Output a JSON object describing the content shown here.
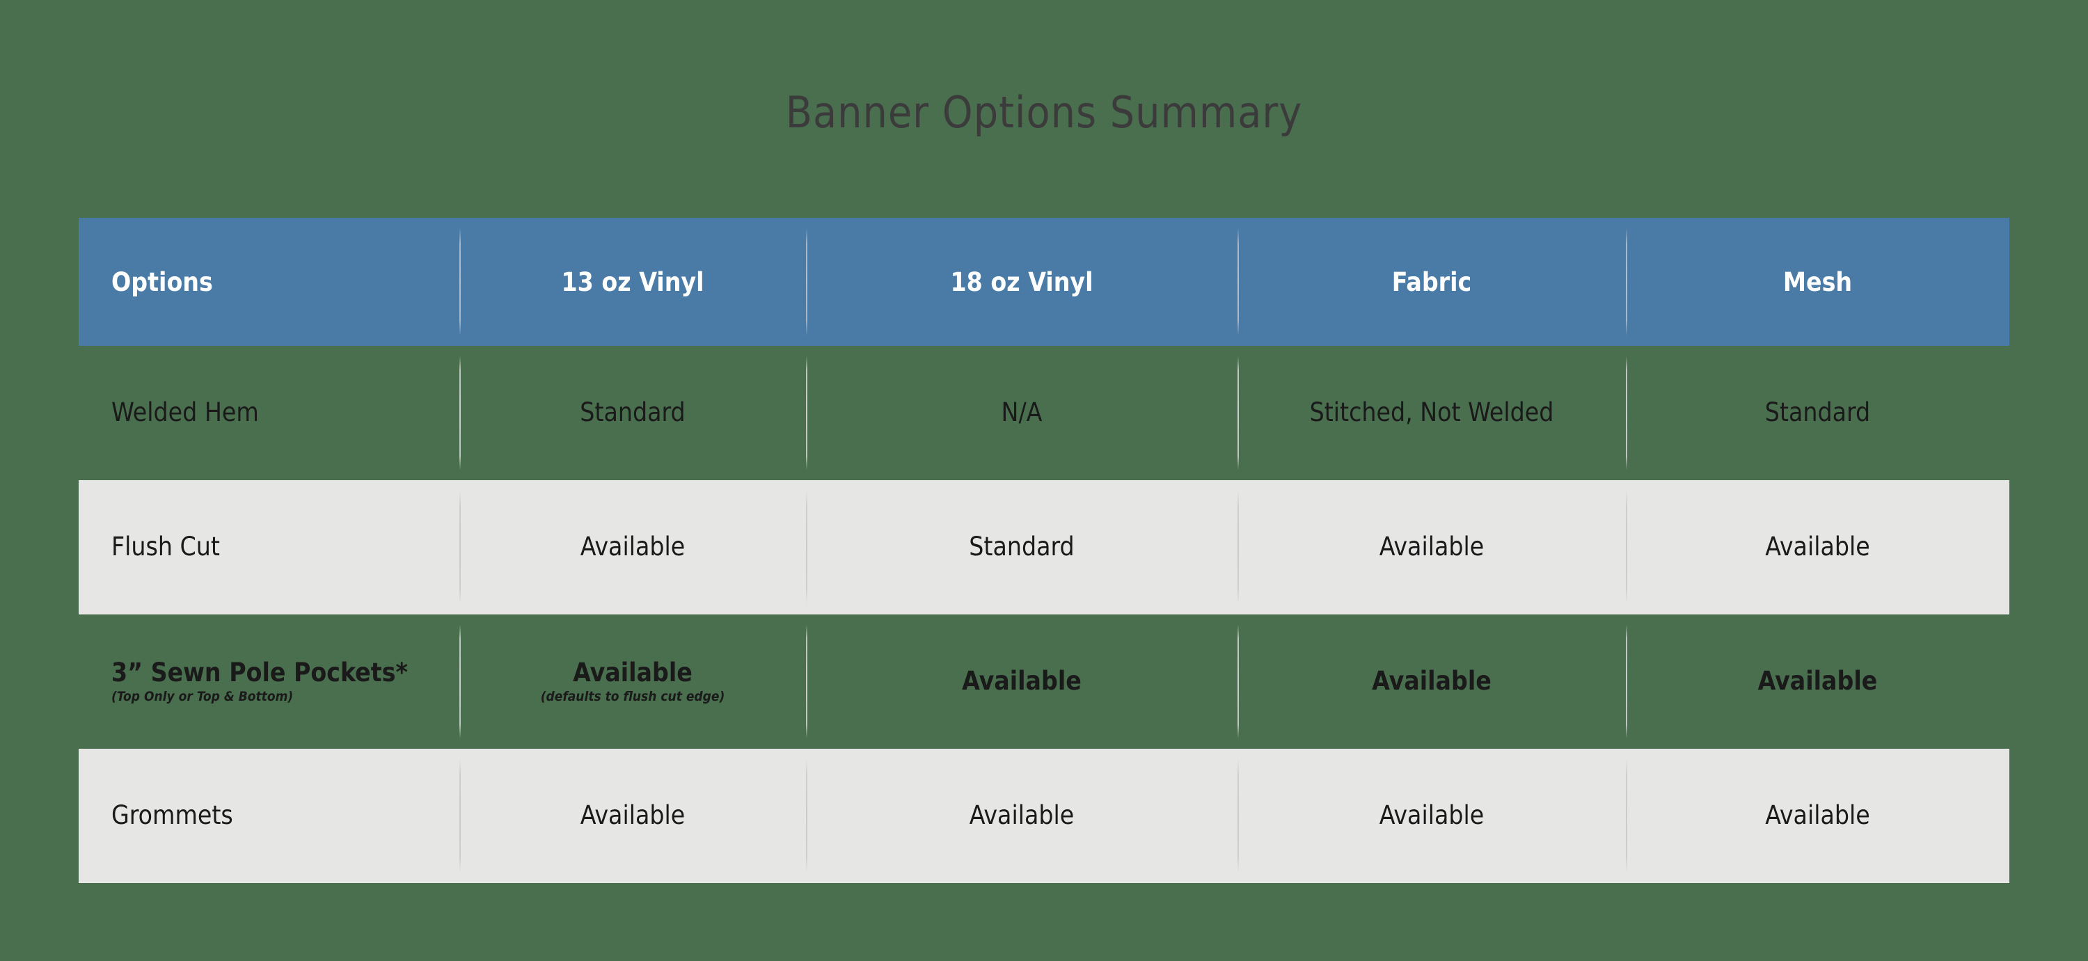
{
  "page": {
    "title": "Banner Options Summary",
    "background_color": "#4a6f4e",
    "header_color": "#4a7ba6",
    "stripe_color": "#e6e6e4",
    "title_color": "#3b3b3b"
  },
  "table": {
    "columns": [
      {
        "label": "Options"
      },
      {
        "label": "13 oz Vinyl"
      },
      {
        "label": "18 oz Vinyl"
      },
      {
        "label": "Fabric"
      },
      {
        "label": "Mesh"
      }
    ],
    "rows": [
      {
        "band": "green",
        "emphasis": "normal",
        "option": "Welded Hem",
        "option_sub": "",
        "cells": [
          {
            "value": "Standard",
            "sub": ""
          },
          {
            "value": "N/A",
            "sub": ""
          },
          {
            "value": "Stitched, Not Welded",
            "sub": ""
          },
          {
            "value": "Standard",
            "sub": ""
          }
        ]
      },
      {
        "band": "gray",
        "emphasis": "normal",
        "option": "Flush Cut",
        "option_sub": "",
        "cells": [
          {
            "value": "Available",
            "sub": ""
          },
          {
            "value": "Standard",
            "sub": ""
          },
          {
            "value": "Available",
            "sub": ""
          },
          {
            "value": "Available",
            "sub": ""
          }
        ]
      },
      {
        "band": "green",
        "emphasis": "bold",
        "option": "3” Sewn Pole Pockets*",
        "option_sub": "(Top Only or Top & Bottom)",
        "cells": [
          {
            "value": "Available",
            "sub": "(defaults to flush cut edge)"
          },
          {
            "value": "Available",
            "sub": ""
          },
          {
            "value": "Available",
            "sub": ""
          },
          {
            "value": "Available",
            "sub": ""
          }
        ]
      },
      {
        "band": "gray",
        "emphasis": "normal",
        "option": "Grommets",
        "option_sub": "",
        "cells": [
          {
            "value": "Available",
            "sub": ""
          },
          {
            "value": "Available",
            "sub": ""
          },
          {
            "value": "Available",
            "sub": ""
          },
          {
            "value": "Available",
            "sub": ""
          }
        ]
      }
    ]
  }
}
